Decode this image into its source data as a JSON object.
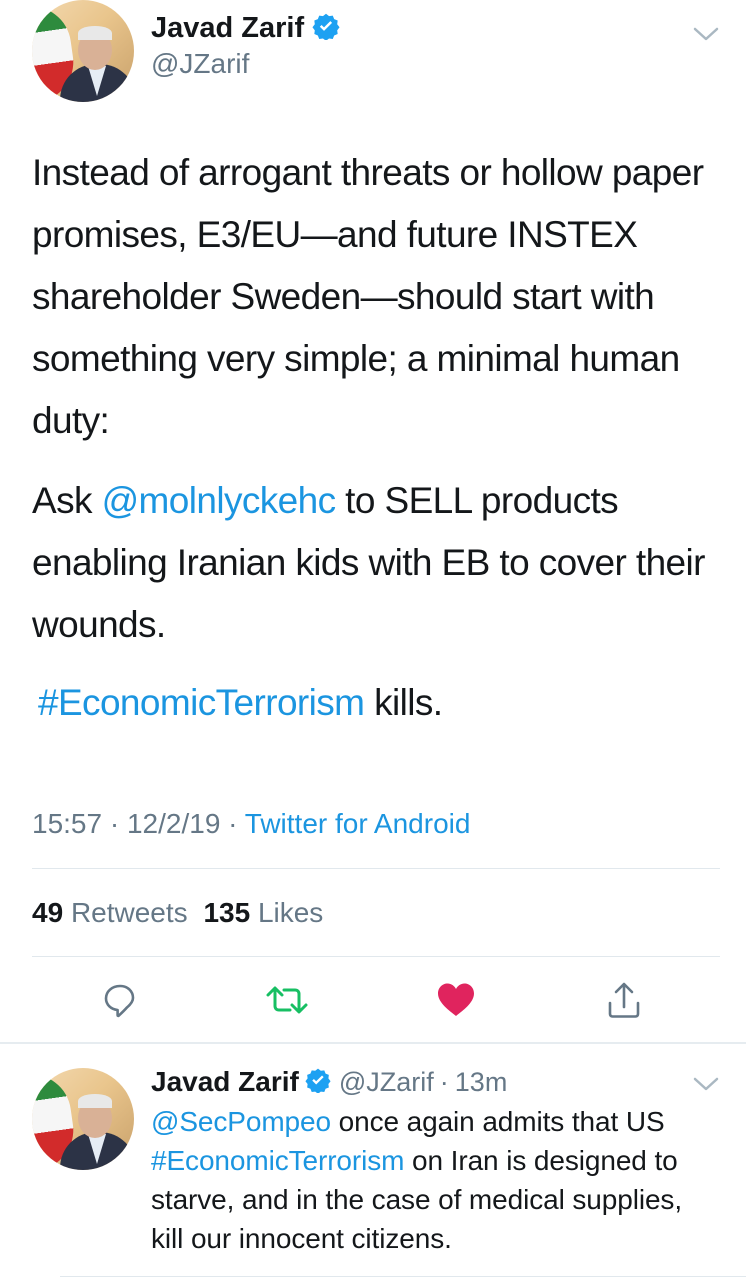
{
  "main_tweet": {
    "author_name": "Javad Zarif",
    "author_handle": "@JZarif",
    "paragraph1": "Instead of arrogant threats or hollow paper promises, E3/EU—and future INSTEX shareholder Sweden—should start with something very simple; a minimal human duty:",
    "paragraph2_prefix": "Ask ",
    "paragraph2_mention": "@molnlyckehc",
    "paragraph2_suffix": " to SELL products enabling Iranian kids with EB to cover their wounds.",
    "paragraph3_hashtag": "#EconomicTerrorism",
    "paragraph3_suffix": " kills.",
    "time": "15:57",
    "date": "12/2/19",
    "source": "Twitter for Android",
    "separator": "·",
    "retweets_count": "49",
    "retweets_label": "Retweets",
    "likes_count": "135",
    "likes_label": "Likes",
    "icons": [
      "reply-icon",
      "retweet-icon",
      "like-icon",
      "share-icon"
    ]
  },
  "reply_tweet": {
    "author_name": "Javad Zarif",
    "author_handle": "@JZarif",
    "separator": "·",
    "time_ago": "13m",
    "mention": "@SecPompeo",
    "text1": " once again admits that US",
    "hashtag": "#EconomicTerrorism",
    "text2": " on Iran is designed to starve, and in the case of medical supplies, kill our innocent citizens."
  },
  "colors": {
    "link": "#1b95e0",
    "verified": "#1da1f2",
    "retweet": "#17bf63",
    "like": "#e0245e",
    "secondary_text": "#657786"
  }
}
